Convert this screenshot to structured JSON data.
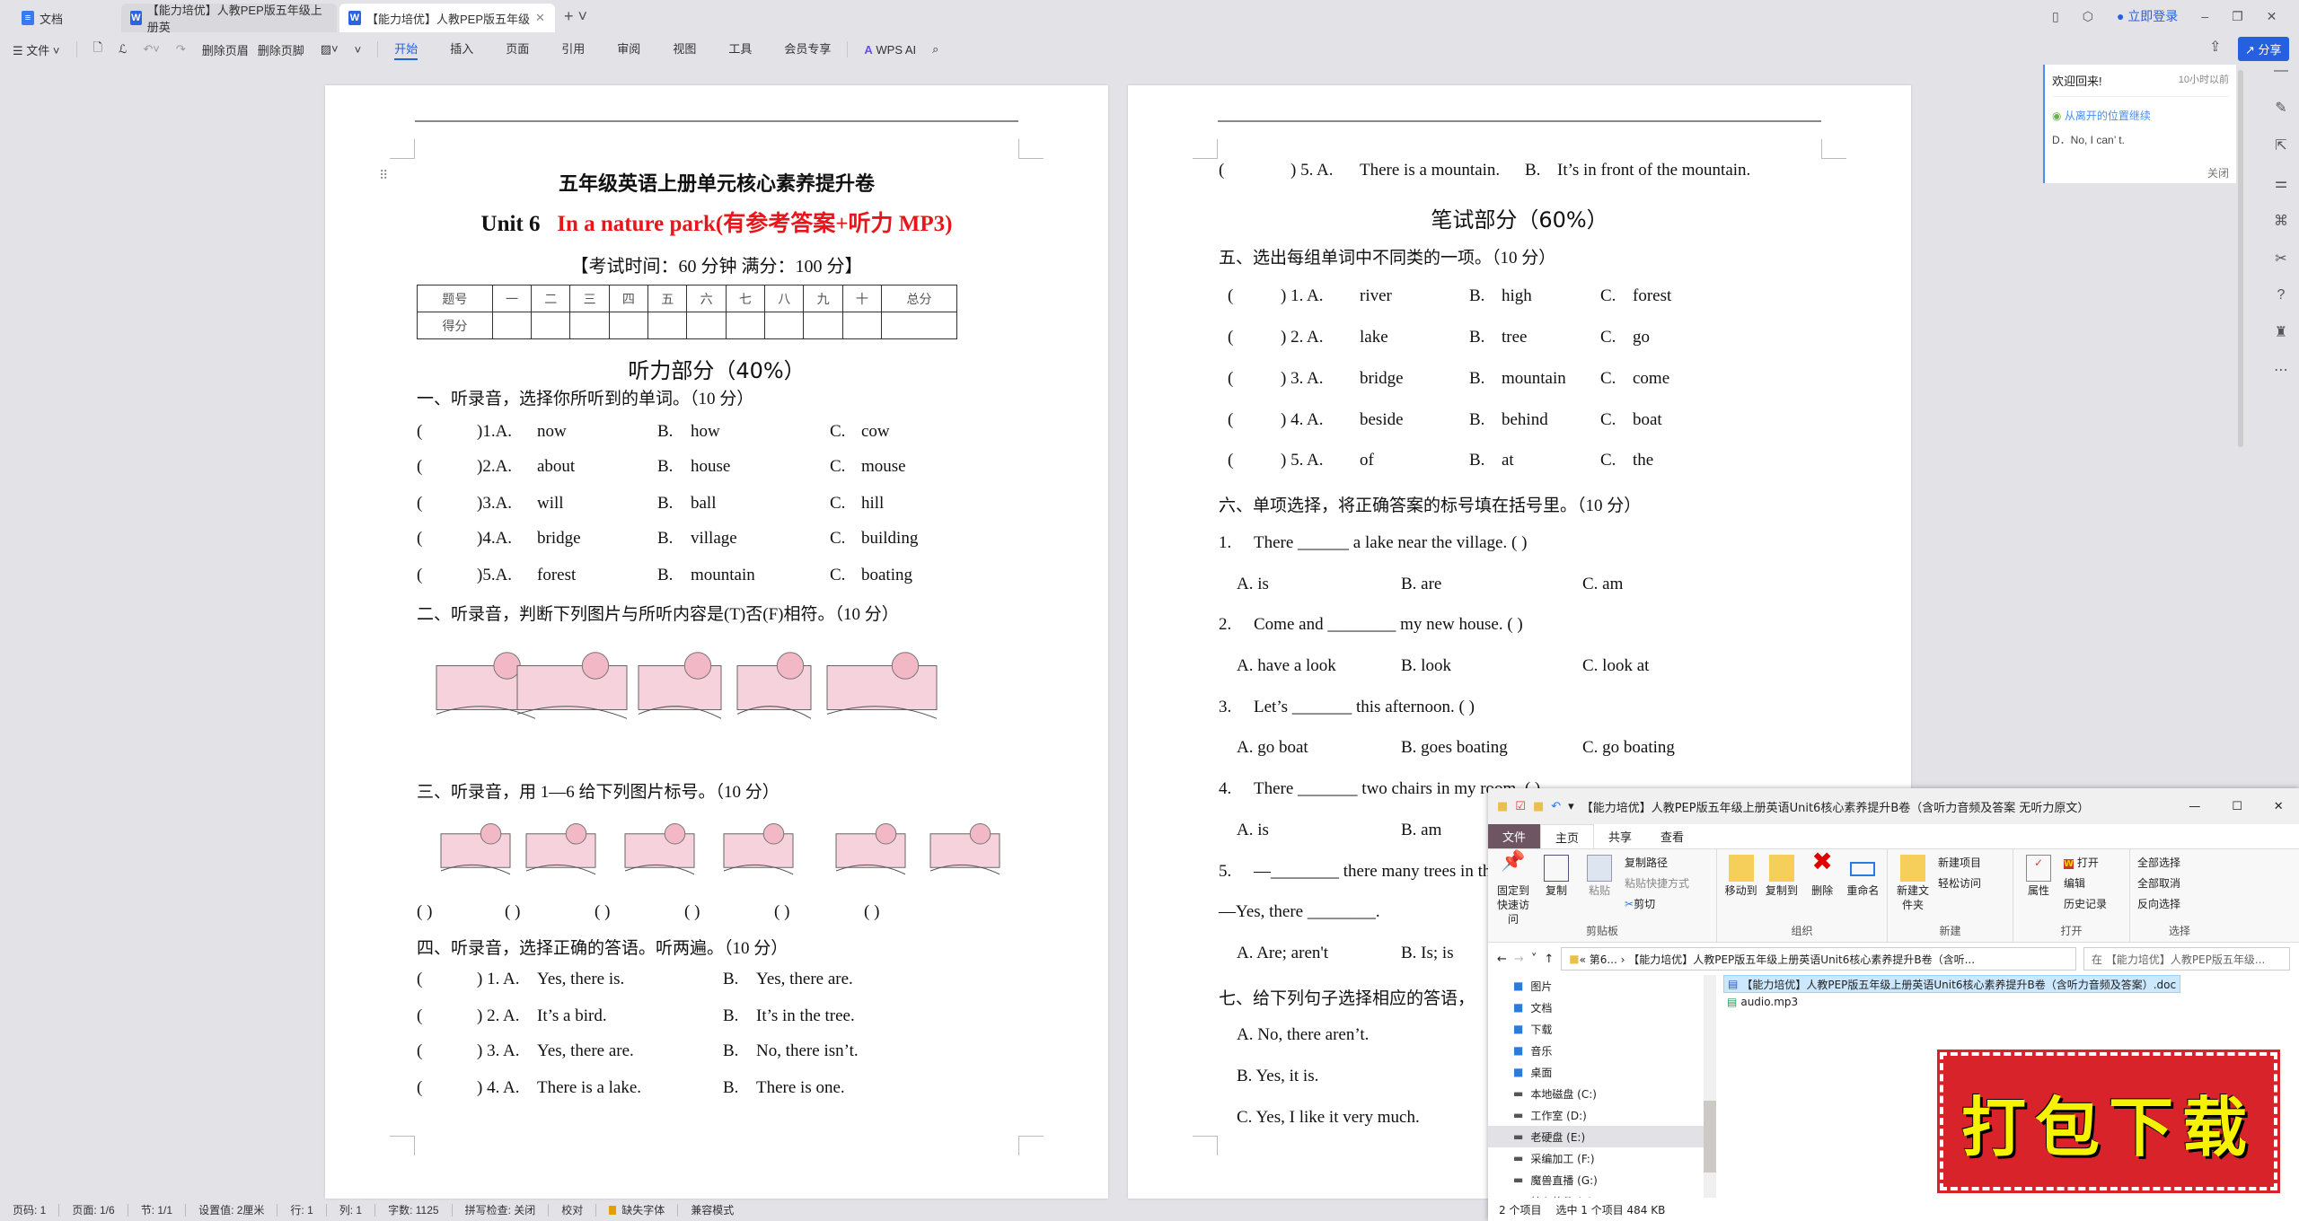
{
  "tabs": [
    {
      "label": "文档"
    },
    {
      "label": "【能力培优】人教PEP版五年级上册英"
    },
    {
      "label": "【能力培优】人教PEP版五年级"
    }
  ],
  "toolbar": {
    "file": "文件",
    "delete_header": "删除页眉",
    "delete_footer": "删除页脚",
    "menus": [
      "开始",
      "插入",
      "页面",
      "引用",
      "审阅",
      "视图",
      "工具",
      "会员专享"
    ],
    "wps_ai": "WPS AI"
  },
  "account": {
    "login": "立即登录",
    "share": "分享"
  },
  "welcome": {
    "title": "欢迎回来!",
    "time": "10小时以前",
    "resume": "从离开的位置继续",
    "snippet": "D．No, I can’ t.",
    "close": "关闭"
  },
  "page1": {
    "title": "五年级英语上册单元核心素养提升卷",
    "unit": "Unit 6",
    "unit_title": "In a nature park(有参考答案+听力 MP3)",
    "exam_info": "【考试时间：60 分钟 满分：100 分】",
    "score_table": {
      "header": [
        "题号",
        "一",
        "二",
        "三",
        "四",
        "五",
        "六",
        "七",
        "八",
        "九",
        "十",
        "总分"
      ],
      "row_label": "得分"
    },
    "listening": "听力部分（40%）",
    "s1": "一、听录音，选择你所听到的单词。（10 分）",
    "s1_rows": [
      [
        "(",
        ")1.A.",
        "now",
        "B.",
        "how",
        "C.",
        "cow"
      ],
      [
        "(",
        ")2.A.",
        "about",
        "B.",
        "house",
        "C.",
        "mouse"
      ],
      [
        "(",
        ")3.A.",
        "will",
        "B.",
        "ball",
        "C.",
        "hill"
      ],
      [
        "(",
        ")4.A.",
        "bridge",
        "B.",
        "village",
        "C.",
        "building"
      ],
      [
        "(",
        ")5.A.",
        "forest",
        "B.",
        "mountain",
        "C.",
        "boating"
      ]
    ],
    "s2": "二、听录音，判断下列图片与所听内容是(T)否(F)相符。（10 分）",
    "s3": "三、听录音，用 1—6 给下列图片标号。（10 分）",
    "s3_blanks": [
      "(        )",
      "(        )",
      "(        )",
      "(        )",
      "(        )",
      "(        )"
    ],
    "s4": "四、听录音，选择正确的答语。听两遍。（10 分）",
    "s4_rows": [
      [
        "(",
        ") 1. A.",
        "Yes, there is.",
        "B.",
        "Yes, there are."
      ],
      [
        "(",
        ") 2. A.",
        "It’s a bird.",
        "B.",
        "It’s in the tree."
      ],
      [
        "(",
        ") 3. A.",
        "Yes, there are.",
        "B.",
        "No, there isn’t."
      ],
      [
        "(",
        ") 4. A.",
        "There is a lake.",
        "B.",
        "There is one."
      ]
    ]
  },
  "page2": {
    "q5": [
      "(",
      ") 5. A.",
      "There is a mountain.",
      "B.",
      "It’s in front of the mountain."
    ],
    "writing": "笔试部分（60%）",
    "s5": "五、选出每组单词中不同类的一项。（10 分）",
    "s5_rows": [
      [
        "(",
        ") 1.  A.",
        "river",
        "B.",
        "high",
        "C.",
        "forest"
      ],
      [
        "(",
        ") 2.  A.",
        "lake",
        "B.",
        "tree",
        "C.",
        "go"
      ],
      [
        "(",
        ") 3.  A.",
        "bridge",
        "B.",
        "mountain",
        "C.",
        "come"
      ],
      [
        "(",
        ") 4.  A.",
        "beside",
        "B.",
        "behind",
        "C.",
        "boat"
      ],
      [
        "(",
        ") 5.  A.",
        "of",
        "B.",
        "at",
        "C.",
        "the"
      ]
    ],
    "s6": "六、单项选择，将正确答案的标号填在括号里。（10 分）",
    "s6_items": [
      {
        "n": "1.",
        "q": "There ______ a lake near the village. (      )",
        "a": "A.  is",
        "b": "B.  are",
        "c": "C.  am"
      },
      {
        "n": "2.",
        "q": "Come and ________ my new house.  (        )",
        "a": "A.  have a look",
        "b": "B.  look",
        "c": "C.  look at"
      },
      {
        "n": "3.",
        "q": "Let’s _______ this afternoon. (      )",
        "a": "A.  go boat",
        "b": "B.  goes boating",
        "c": "C.  go boating"
      },
      {
        "n": "4.",
        "q": "There _______ two chairs in my room. (        )",
        "a": "A.  is",
        "b": "B.  am",
        "c": ""
      }
    ],
    "s6_q5": {
      "n": "5.",
      "q": "—________ there many trees in the park?",
      "q2": "—Yes, there ________.",
      "a": "A.  Are; aren't",
      "b": "B.  Is; is"
    },
    "s7": "七、给下列句子选择相应的答语，",
    "s7_options": [
      "A.  No, there aren’t.",
      "B.  Yes, it is.",
      "C.  Yes, I like it very much."
    ]
  },
  "status": [
    "页码: 1",
    "页面: 1/6",
    "节: 1/1",
    "设置值: 2厘米",
    "行: 1",
    "列: 1",
    "字数: 1125",
    "拼写检查: 关闭",
    "校对",
    "缺失字体",
    "兼容模式"
  ],
  "explorer": {
    "title": "【能力培优】人教PEP版五年级上册英语Unit6核心素养提升B卷（含听力音频及答案 无听力原文）",
    "tabs": [
      "文件",
      "主页",
      "共享",
      "查看"
    ],
    "ribbon": {
      "pin": "固定到快速访问",
      "copy": "复制",
      "paste": "粘贴",
      "copy_path": "复制路径",
      "paste_shortcut": "粘贴快捷方式",
      "cut": "剪切",
      "clipboard": "剪贴板",
      "move_to": "移动到",
      "copy_to": "复制到",
      "delete": "删除",
      "rename": "重命名",
      "organize": "组织",
      "new_folder": "新建文件夹",
      "new_item": "新建项目",
      "easy_access": "轻松访问",
      "new": "新建",
      "properties": "属性",
      "open": "打开",
      "edit": "编辑",
      "history": "历史记录",
      "open_group": "打开",
      "select_all": "全部选择",
      "select_none": "全部取消",
      "invert": "反向选择",
      "select": "选择"
    },
    "address": "«  第6...  ›  【能力培优】人教PEP版五年级上册英语Unit6核心素养提升B卷（含听...",
    "search_placeholder": "在 【能力培优】人教PEP版五年级...",
    "nav": [
      "图片",
      "文档",
      "下载",
      "音乐",
      "桌面",
      "本地磁盘 (C:)",
      "工作室 (D:)",
      "老硬盘 (E:)",
      "采编加工 (F:)",
      "魔兽直播 (G:)",
      "核心软件 (J:)"
    ],
    "nav_selected": "老硬盘 (E:)",
    "files": [
      "【能力培优】人教PEP版五年级上册英语Unit6核心素养提升B卷（含听力音频及答案）.doc",
      "audio.mp3"
    ],
    "status_count": "2 个项目",
    "status_selected": "选中 1 个项目  484 KB"
  },
  "stamp": "打包下载",
  "colors": {
    "accent": "#2660e0",
    "red_title": "#e8161b",
    "stamp_red": "#d8232a",
    "stamp_text": "#f6f200"
  }
}
